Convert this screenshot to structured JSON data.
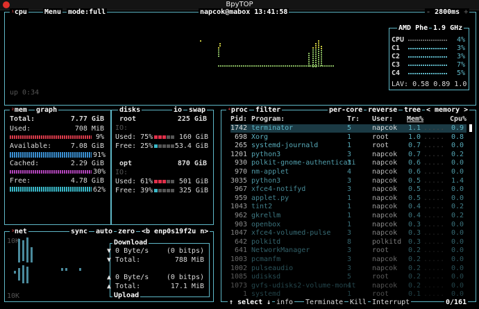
{
  "window": {
    "title": "BpyTOP"
  },
  "cpu_box": {
    "tab_num": "¹",
    "tab": "cpu",
    "menu": "Menu",
    "mode": "mode:full",
    "host_time": "napcok@mabox 13:41:58",
    "interval": "2800ms",
    "uptime": "up 0:34",
    "cpu_model": "AMD Phe",
    "freq": "1.9 GHz",
    "cores": [
      {
        "label": "CPU",
        "pct": "4%"
      },
      {
        "label": "C1",
        "pct": "3%"
      },
      {
        "label": "C2",
        "pct": "3%"
      },
      {
        "label": "C3",
        "pct": "7%"
      },
      {
        "label": "C4",
        "pct": "5%"
      }
    ],
    "lav_label": "LAV:",
    "lav": "0.58 0.89 1.0"
  },
  "mem_box": {
    "tab_num": "²",
    "tab": "mem",
    "graph": "graph",
    "total_label": "Total:",
    "total": "7.77 GiB",
    "used_label": "Used:",
    "used": "708 MiB",
    "used_pct": "9%",
    "available_label": "Available:",
    "available": "7.08 GiB",
    "available_pct": "91%",
    "cached_label": "Cached:",
    "cached": "2.29 GiB",
    "cached_pct": "30%",
    "free_label": "Free:",
    "free": "4.78 GiB",
    "free_pct": "62%"
  },
  "disks_box": {
    "tab": "disks",
    "io": "io",
    "swap": "swap",
    "disks": [
      {
        "name": "root",
        "total": "225 GiB",
        "io_label": "IO:",
        "used_label": "Used:",
        "used_pct": "75%",
        "used": "160 GiB",
        "free_label": "Free:",
        "free_pct": "25%",
        "free": "53.4 GiB"
      },
      {
        "name": "opt",
        "total": "870 GiB",
        "io_label": "IO:",
        "used_label": "Used:",
        "used_pct": "61%",
        "used": "501 GiB",
        "free_label": "Free:",
        "free_pct": "39%",
        "free": "325 GiB"
      }
    ]
  },
  "net_box": {
    "tab_num": "³",
    "tab": "net",
    "sync": "sync",
    "auto": "auto",
    "zero": "zero",
    "iface": "<b enp0s19f2u n>",
    "scale_top": "10K",
    "scale_bottom": "10K",
    "download_title": "Download",
    "dl_rate": "0 Byte/s",
    "dl_bits": "(0 bitps)",
    "dl_total_label": "Total:",
    "dl_total": "788 MiB",
    "ul_rate": "0 Byte/s",
    "ul_bits": "(0 bitps)",
    "ul_total_label": "Total:",
    "ul_total": "17.1 MiB",
    "upload_title": "Upload"
  },
  "proc_box": {
    "tab_num": "⁴",
    "tab": "proc",
    "filter": "filter",
    "per_core": "per-core",
    "reverse": "reverse",
    "tree": "tree",
    "sort": "< memory >",
    "headers": {
      "pid": "Pid:",
      "program": "Program:",
      "threads": "Tr:",
      "user": "User:",
      "mem": "Mem%",
      "cpu": "Cpu%"
    },
    "processes": [
      {
        "pid": "1742",
        "program": "terminator",
        "threads": "5",
        "user": "napcok",
        "mem": "1.1",
        "cpu": "0.9"
      },
      {
        "pid": "698",
        "program": "Xorg",
        "threads": "1",
        "user": "root",
        "mem": "1.0",
        "cpu": "0.8"
      },
      {
        "pid": "265",
        "program": "systemd-journald",
        "threads": "1",
        "user": "root",
        "mem": "0.7",
        "cpu": "0.0"
      },
      {
        "pid": "1201",
        "program": "python3",
        "threads": "3",
        "user": "napcok",
        "mem": "0.7",
        "cpu": "0.2"
      },
      {
        "pid": "930",
        "program": "polkit-gnome-authenticati",
        "threads": "3",
        "user": "napcok",
        "mem": "0.6",
        "cpu": "0.0"
      },
      {
        "pid": "970",
        "program": "nm-applet",
        "threads": "4",
        "user": "napcok",
        "mem": "0.6",
        "cpu": "0.0"
      },
      {
        "pid": "3035",
        "program": "python3",
        "threads": "3",
        "user": "napcok",
        "mem": "0.5",
        "cpu": "1.4"
      },
      {
        "pid": "967",
        "program": "xfce4-notifyd",
        "threads": "3",
        "user": "napcok",
        "mem": "0.5",
        "cpu": "0.0"
      },
      {
        "pid": "959",
        "program": "applet.py",
        "threads": "1",
        "user": "napcok",
        "mem": "0.5",
        "cpu": "0.0"
      },
      {
        "pid": "1043",
        "program": "tint2",
        "threads": "1",
        "user": "napcok",
        "mem": "0.4",
        "cpu": "0.2"
      },
      {
        "pid": "962",
        "program": "gkrellm",
        "threads": "1",
        "user": "napcok",
        "mem": "0.4",
        "cpu": "0.2"
      },
      {
        "pid": "903",
        "program": "openbox",
        "threads": "1",
        "user": "napcok",
        "mem": "0.3",
        "cpu": "0.0"
      },
      {
        "pid": "1047",
        "program": "xfce4-volumed-pulse",
        "threads": "3",
        "user": "napcok",
        "mem": "0.3",
        "cpu": "0.0"
      },
      {
        "pid": "642",
        "program": "polkitd",
        "threads": "8",
        "user": "polkitd",
        "mem": "0.3",
        "cpu": "0.0"
      },
      {
        "pid": "641",
        "program": "NetworkManager",
        "threads": "3",
        "user": "root",
        "mem": "0.2",
        "cpu": "0.0"
      },
      {
        "pid": "1003",
        "program": "pcmanfm",
        "threads": "3",
        "user": "napcok",
        "mem": "0.2",
        "cpu": "0.0"
      },
      {
        "pid": "1002",
        "program": "pulseaudio",
        "threads": "3",
        "user": "napcok",
        "mem": "0.2",
        "cpu": "0.0"
      },
      {
        "pid": "1085",
        "program": "udisksd",
        "threads": "5",
        "user": "root",
        "mem": "0.2",
        "cpu": "0.0"
      },
      {
        "pid": "1073",
        "program": "gvfs-udisks2-volume-monit",
        "threads": "4",
        "user": "napcok",
        "mem": "0.2",
        "cpu": "0.0"
      },
      {
        "pid": "1",
        "program": "systemd",
        "threads": "1",
        "user": "root",
        "mem": "0.1",
        "cpu": "0.0"
      }
    ],
    "footer": {
      "select": "↑ select ↓",
      "info": "info",
      "terminate": "Terminate",
      "kill": "Kill",
      "interrupt": "Interrupt",
      "count": "0/161"
    }
  }
}
